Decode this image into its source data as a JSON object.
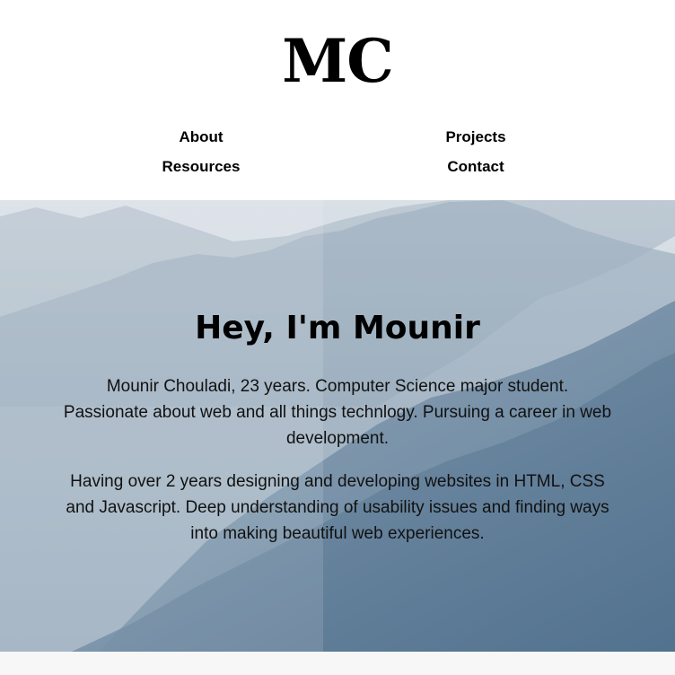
{
  "header": {
    "logo": "MC",
    "nav": {
      "about": "About",
      "projects": "Projects",
      "resources": "Resources",
      "contact": "Contact"
    }
  },
  "hero": {
    "title": "Hey, I'm Mounir",
    "paragraphs": [
      "Mounir Chouladi, 23 years. Computer Science major student. Passionate about web and all things technlogy. Pursuing a career in web development.",
      "Having over 2 years designing and developing websites in HTML, CSS and Javascript. Deep understanding of usability issues and finding ways into making beautiful web experiences."
    ],
    "background": "misty-mountains-image"
  },
  "colors": {
    "text": "#000000",
    "header_background": "#ffffff",
    "hero_sky": "#c9d3dc",
    "mountain_dark": "#5d7c97",
    "footer_strip": "#f7f7f7"
  }
}
